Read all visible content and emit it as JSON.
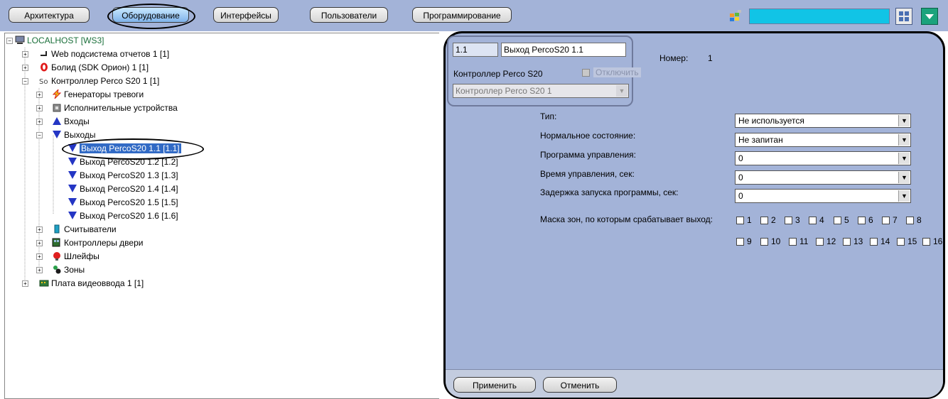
{
  "tabs": [
    {
      "label": "Архитектура"
    },
    {
      "label": "Оборудование"
    },
    {
      "label": "Интерфейсы"
    },
    {
      "label": "Пользователи"
    },
    {
      "label": "Программирование"
    }
  ],
  "tree": {
    "root": "LOCALHOST [WS3]",
    "items": [
      {
        "label": "Web подсистема отчетов 1 [1]"
      },
      {
        "label": "Болид (SDK Орион) 1 [1]"
      },
      {
        "label": "Контроллер Perco S20 1 [1]"
      },
      {
        "label": "Генераторы тревоги"
      },
      {
        "label": "Исполнительные устройства"
      },
      {
        "label": "Входы"
      },
      {
        "label": "Выходы"
      },
      {
        "label": "Выход PercoS20 1.1 [1.1]"
      },
      {
        "label": "Выход PercoS20 1.2 [1.2]"
      },
      {
        "label": "Выход PercoS20 1.3 [1.3]"
      },
      {
        "label": "Выход PercoS20 1.4 [1.4]"
      },
      {
        "label": "Выход PercoS20 1.5 [1.5]"
      },
      {
        "label": "Выход PercoS20 1.6 [1.6]"
      },
      {
        "label": "Считыватели"
      },
      {
        "label": "Контроллеры двери"
      },
      {
        "label": "Шлейфы"
      },
      {
        "label": "Зоны"
      },
      {
        "label": "Плата видеоввода 1 [1]"
      }
    ]
  },
  "header": {
    "id_value": "1.1",
    "name_value": "Выход PercoS20 1.1",
    "number_label": "Номер:",
    "number_value": "1",
    "parent_label": "Контроллер Perco S20",
    "disable_label": "Отключить",
    "parent_select": "Контроллер Perco S20 1"
  },
  "props": {
    "type_label": "Тип:",
    "type_value": "Не используется",
    "normal_label": "Нормальное состояние:",
    "normal_value": "Не запитан",
    "program_label": "Программа управления:",
    "program_value": "0",
    "time_label": "Время управления, сек:",
    "time_value": "0",
    "delay_label": "Задержка запуска программы, сек:",
    "delay_value": "0",
    "mask_label": "Маска зон, по которым срабатывает выход:",
    "mask_zones": [
      "1",
      "2",
      "3",
      "4",
      "5",
      "6",
      "7",
      "8",
      "9",
      "10",
      "11",
      "12",
      "13",
      "14",
      "15",
      "16"
    ]
  },
  "buttons": {
    "apply": "Применить",
    "cancel": "Отменить"
  },
  "colors": {
    "panel": "#a3b3d8",
    "search": "#11c4e6",
    "selection": "#316ac5"
  }
}
